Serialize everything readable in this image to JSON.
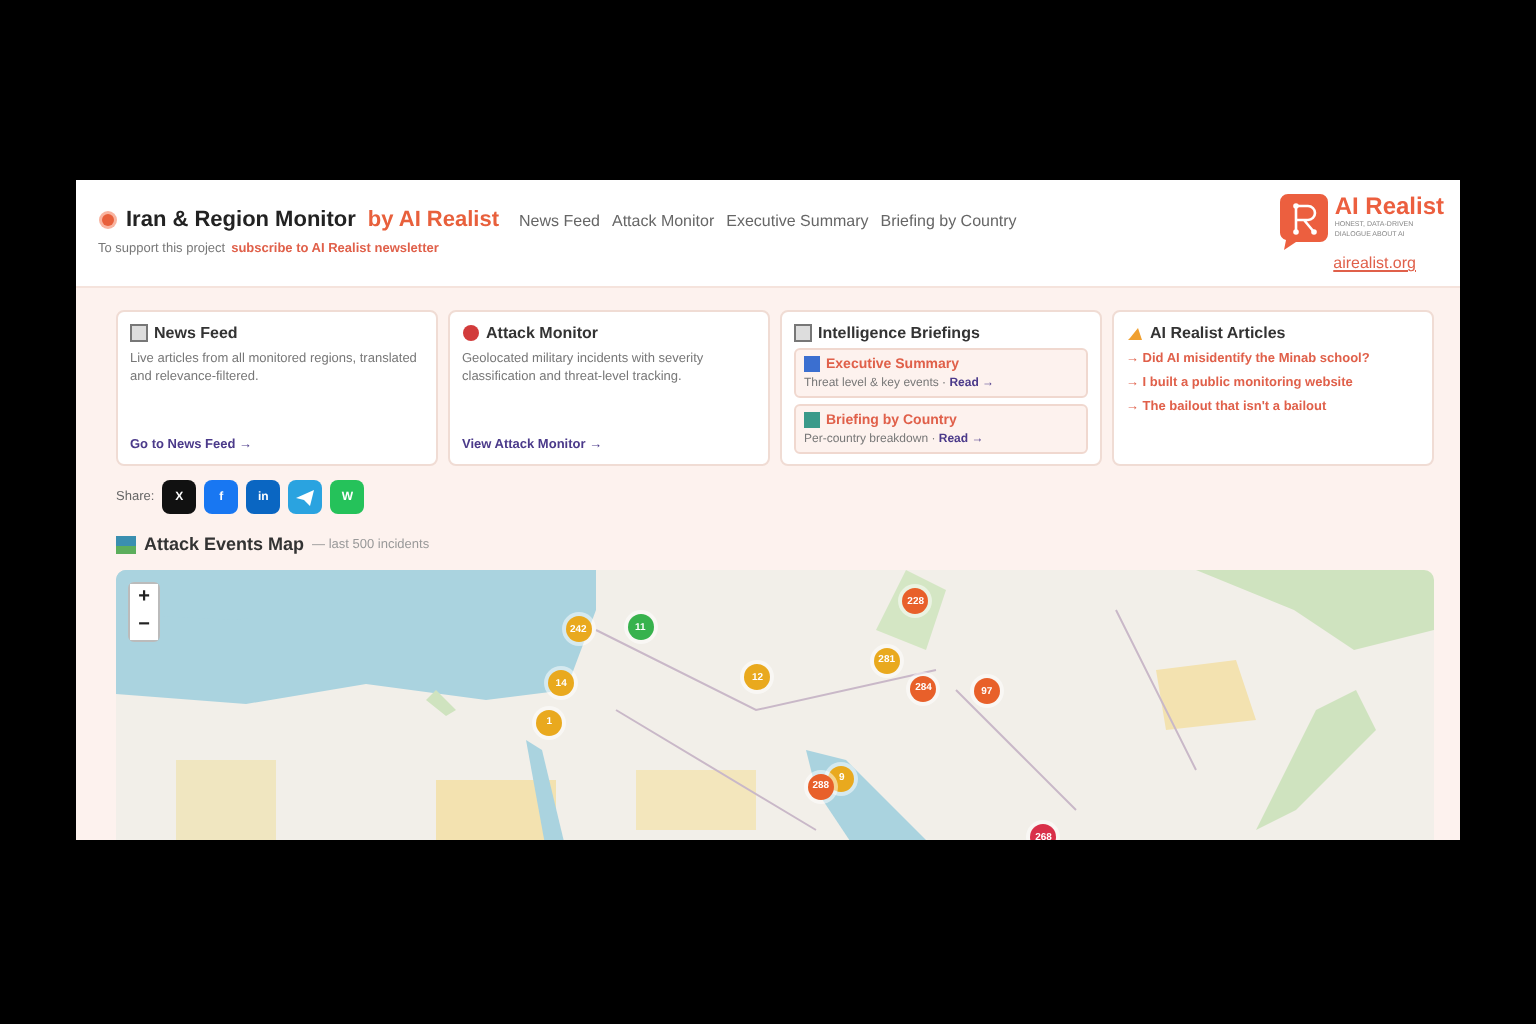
{
  "header": {
    "title": "Iran & Region Monitor",
    "byline": "by AI Realist",
    "nav": [
      {
        "label": "News Feed"
      },
      {
        "label": "Attack Monitor"
      },
      {
        "label": "Executive Summary"
      },
      {
        "label": "Briefing by Country"
      }
    ],
    "support_text": "To support this project",
    "support_link": "subscribe to AI Realist newsletter",
    "logo": {
      "name": "AI Realist",
      "tagline_1": "HONEST, DATA-DRIVEN",
      "tagline_2": "DIALOGUE ABOUT AI",
      "link": "airealist.org"
    }
  },
  "cards": [
    {
      "kind": "text",
      "title": "News Feed",
      "description": "Live articles from all monitored regions, translated and relevance-filtered.",
      "link": "Go to News Feed →"
    },
    {
      "kind": "text",
      "title": "Attack Monitor",
      "description": "Geolocated military incidents with severity classification and threat-level tracking.",
      "link": "View Attack Monitor →"
    },
    {
      "kind": "briefings",
      "title": "Intelligence Briefings",
      "items": [
        {
          "title": "Executive Summary",
          "text": "Threat level & key events ·",
          "link": "Read →"
        },
        {
          "title": "Briefing by Country",
          "text": "Per-country breakdown ·",
          "link": "Read →"
        }
      ]
    },
    {
      "kind": "articles",
      "title": "AI Realist Articles",
      "articles": [
        "→ Did AI misidentify the Minab school?",
        "→ I built a public monitoring website",
        "→ The bailout that isn't a bailout"
      ]
    }
  ],
  "share": {
    "label": "Share:",
    "buttons": [
      {
        "kind": "x",
        "label": "X",
        "color": "#111111"
      },
      {
        "kind": "facebook",
        "label": "f",
        "color": "#1877f2"
      },
      {
        "kind": "linkedin",
        "label": "in",
        "color": "#0a66c2"
      },
      {
        "kind": "telegram",
        "color": "#2aa3e0"
      },
      {
        "kind": "whatsapp",
        "label": "W",
        "color": "#25c25a"
      }
    ]
  },
  "map": {
    "title": "Attack Events Map",
    "subtitle": "— last 500 incidents",
    "zoom_in": "+",
    "zoom_out": "−",
    "markers": [
      {
        "label": "242",
        "color": "#e9a91e"
      },
      {
        "label": "11",
        "color": "#37b24d"
      },
      {
        "label": "228",
        "color": "#e8602a"
      },
      {
        "label": "281",
        "color": "#e9a91e"
      },
      {
        "label": "12",
        "color": "#e9a91e"
      },
      {
        "label": "284",
        "color": "#e8602a"
      },
      {
        "label": "97",
        "color": "#e8602a"
      },
      {
        "label": "14",
        "color": "#e9a91e"
      },
      {
        "label": "1",
        "color": "#e9a91e"
      },
      {
        "label": "9",
        "color": "#e9a91e"
      },
      {
        "label": "288",
        "color": "#e8602a"
      },
      {
        "label": "268",
        "color": "#d9304a"
      }
    ]
  }
}
